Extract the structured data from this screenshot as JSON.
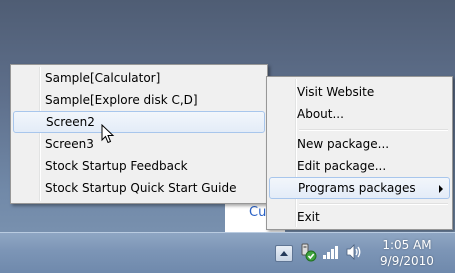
{
  "desktop": {
    "window_fragment_text": "Cu"
  },
  "submenu": {
    "items": [
      {
        "label": "Sample[Calculator]",
        "highlighted": false
      },
      {
        "label": "Sample[Explore disk C,D]",
        "highlighted": false
      },
      {
        "label": "Screen2",
        "highlighted": true
      },
      {
        "label": "Screen3",
        "highlighted": false
      },
      {
        "label": "Stock Startup Feedback",
        "highlighted": false
      },
      {
        "label": "Stock Startup Quick Start Guide",
        "highlighted": false
      }
    ]
  },
  "mainmenu": {
    "items": [
      {
        "label": "Visit Website"
      },
      {
        "label": "About..."
      },
      {
        "label": "New package..."
      },
      {
        "label": "Edit package..."
      },
      {
        "label": "Programs packages",
        "has_submenu": true,
        "highlighted": true
      },
      {
        "label": "Exit"
      }
    ]
  },
  "taskbar": {
    "tray_icons": [
      "show-hidden-icons-arrow",
      "usb-safely-remove-icon",
      "network-signal-icon",
      "volume-speaker-icon"
    ],
    "clock": {
      "time": "1:05 AM",
      "date": "9/9/2010"
    }
  },
  "colors": {
    "menu_bg": "#f0f0f0",
    "highlight_bg": "#e3ecf8",
    "highlight_border": "#a8c6ec",
    "taskbar": "#7c95b6"
  }
}
